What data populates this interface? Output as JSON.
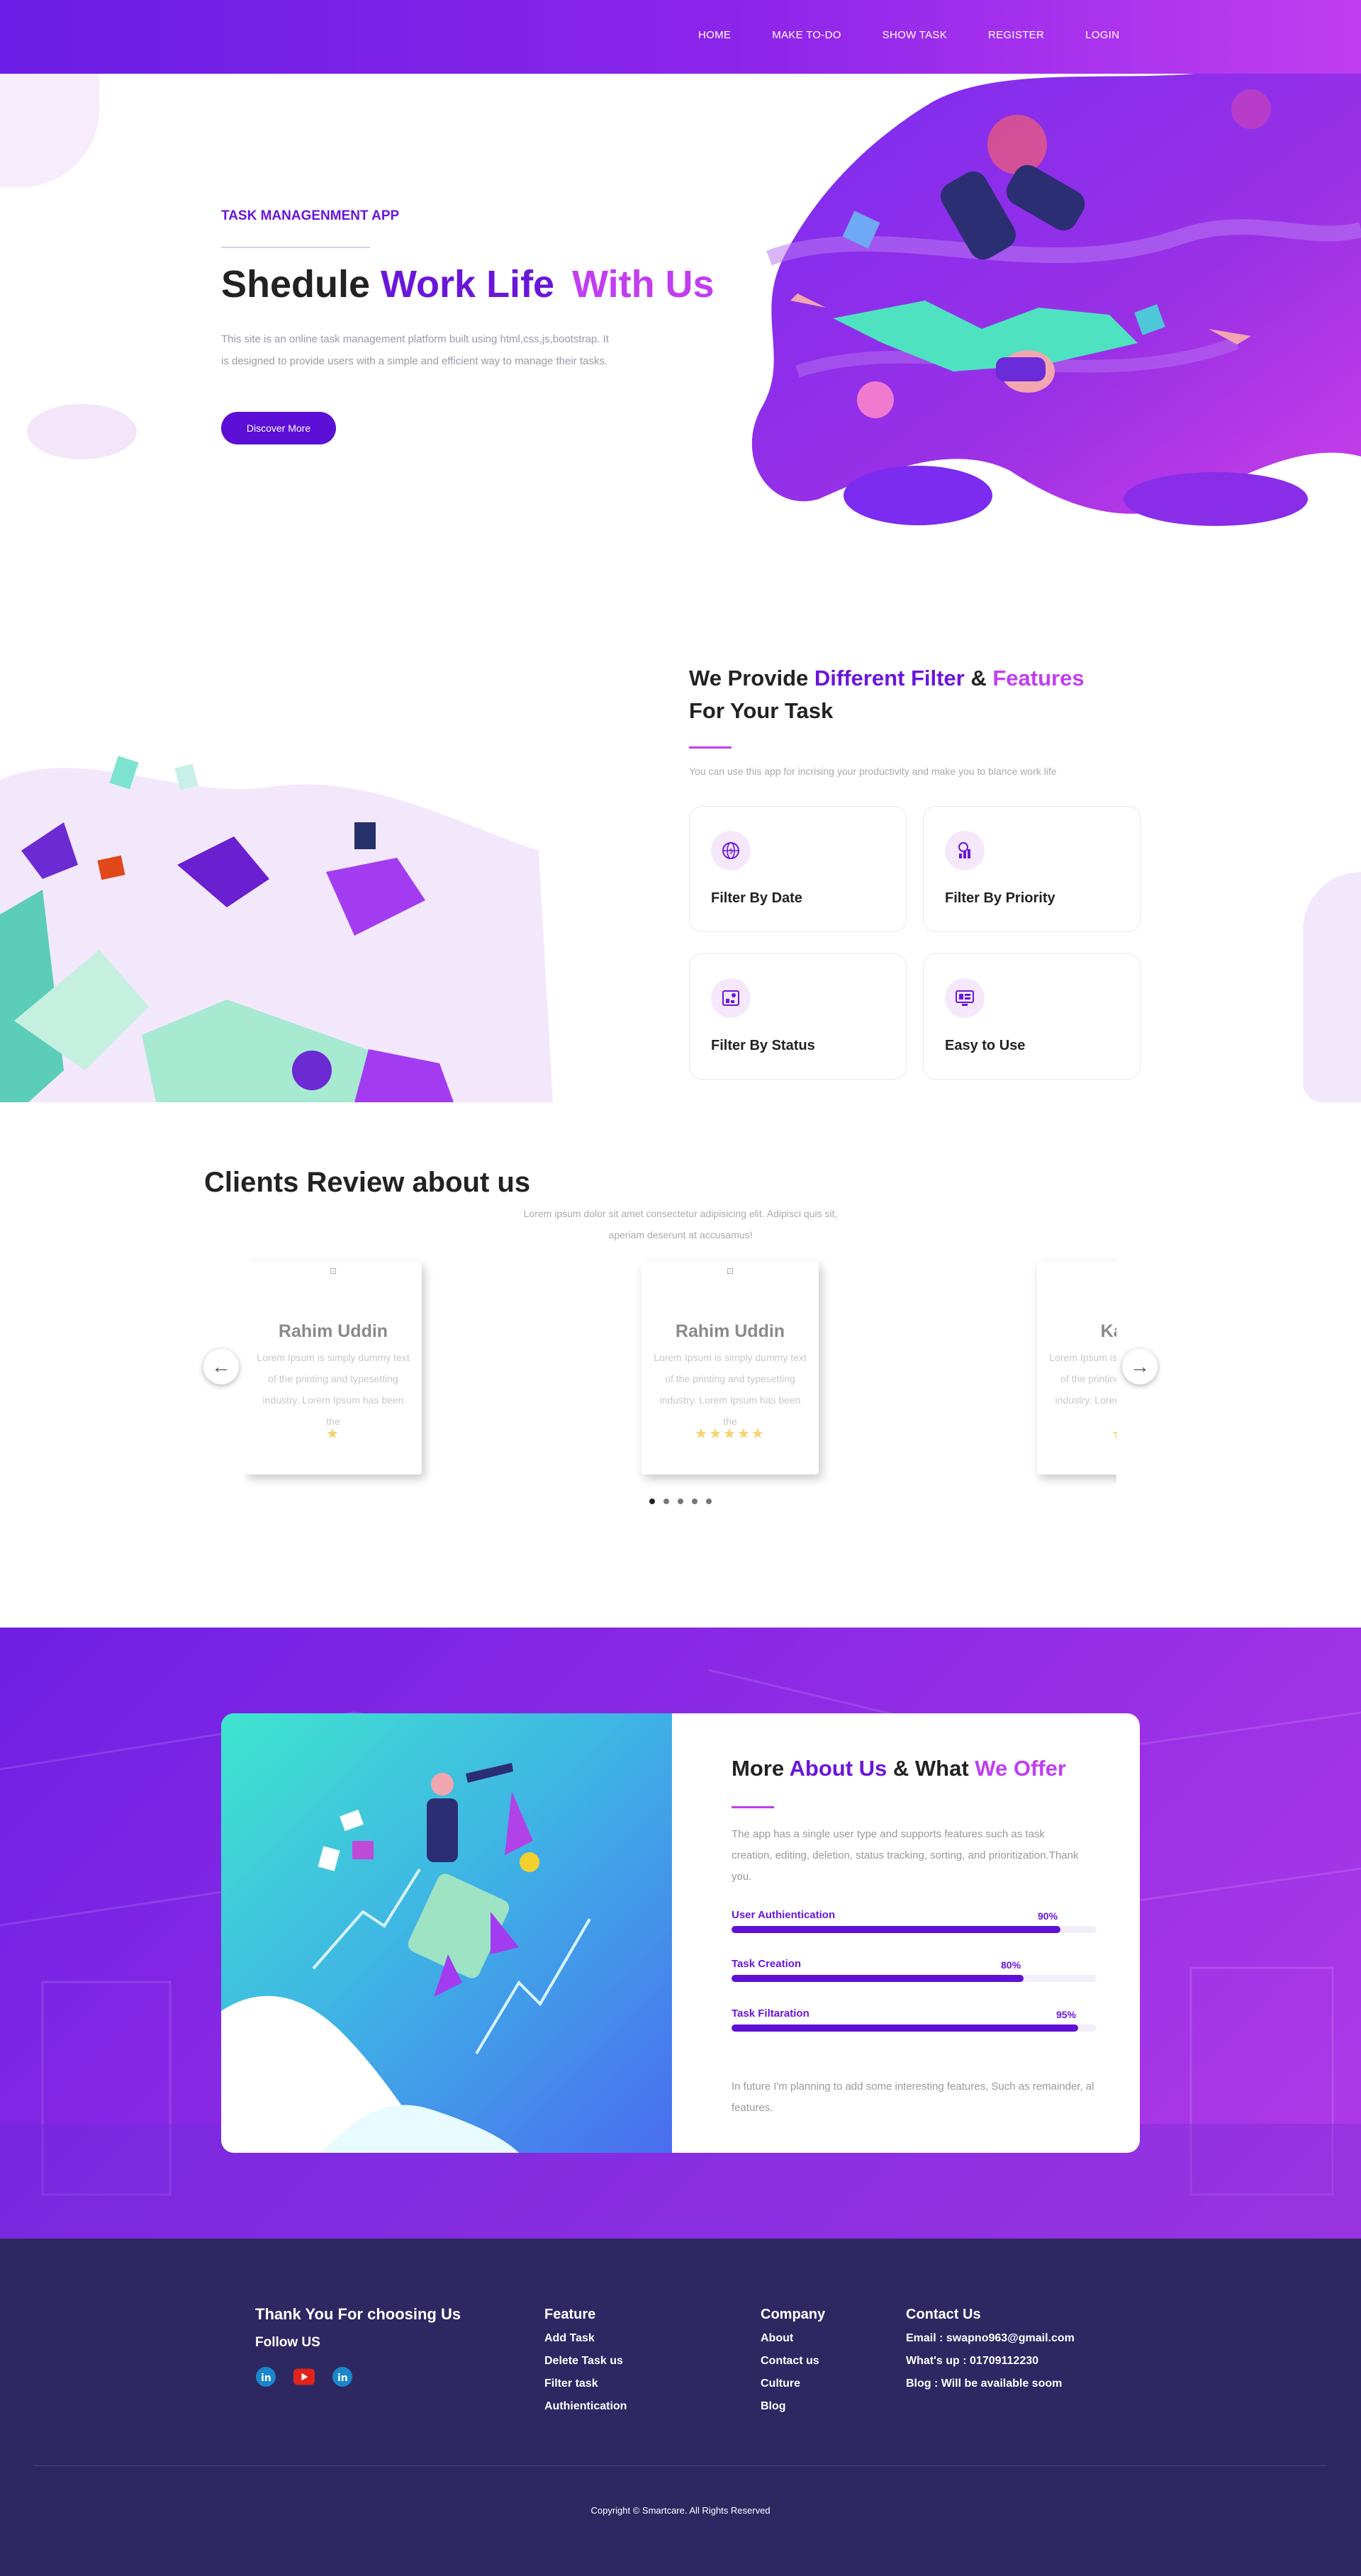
{
  "nav": {
    "items": [
      "HOME",
      "MAKE TO-DO",
      "SHOW TASK",
      "REGISTER",
      "LOGIN"
    ]
  },
  "hero": {
    "kicker": "TASK MANAGENMENT APP",
    "title_a": "Shedule ",
    "title_b": "Work Life ",
    "title_c": "With Us",
    "desc": "This site is an online task management platform built using html,css,js,bootstrap. It is designed to provide users with a simple and efficient way to manage their tasks.",
    "button": "Discover More"
  },
  "features": {
    "title_a": "We Provide ",
    "title_b": "Different Filter",
    "title_c": " & ",
    "title_d": "Features",
    "title_e": "For Your Task",
    "desc": "You can use this app for incrising your productivity and make you to blance work life",
    "cards": [
      {
        "label": "Filter By Date",
        "icon": "globe-icon"
      },
      {
        "label": "Filter By Priority",
        "icon": "chart-user-icon"
      },
      {
        "label": "Filter By Status",
        "icon": "status-board-icon"
      },
      {
        "label": "Easy to Use",
        "icon": "monitor-icon"
      }
    ]
  },
  "reviews": {
    "title": "Clients Review about us",
    "subtitle": "Lorem ipsum dolor sit amet consectetur adipisicing elit. Adipisci quis sit, aperiam deserunt at accusamus!",
    "cards": [
      {
        "name": "Rahim Uddin",
        "text": "Lorem Ipsum is simply dummy text of the printing and typesetting industry. Lorem Ipsum has been the",
        "stars": "★",
        "rating": 1
      },
      {
        "name": "Rahim Uddin",
        "text": "Lorem Ipsum is simply dummy text of the printing and typesetting industry. Lorem Ipsum has been the",
        "stars": "★★★★★",
        "rating": 5
      },
      {
        "name": "Karim",
        "text": "Lorem Ipsum is simply dummy text of the printing and typesetting industry. Lorem Ipsum has been the",
        "stars": "★★",
        "rating": 2
      }
    ],
    "prev_icon": "arrow-left-icon",
    "next_icon": "arrow-right-icon",
    "dots": 5,
    "active_dot": 1
  },
  "about": {
    "title_a": "More ",
    "title_b": "About Us",
    "title_c": " & What ",
    "title_d": "We Offer",
    "desc": "The app has a single user type and supports features such as task creation, editing, deletion, status tracking, sorting, and prioritization.Thank you.",
    "skills": [
      {
        "name": "User Authientication",
        "percent": "90%",
        "value": 90
      },
      {
        "name": "Task Creation",
        "percent": "80%",
        "value": 80
      },
      {
        "name": "Task Filtaration",
        "percent": "95%",
        "value": 95
      }
    ],
    "footer_text": "In future I'm planning to add some interesting features, Such as remainder, al features."
  },
  "footer": {
    "brand": "Thank You For choosing Us",
    "follow": "Follow US",
    "social": [
      "linkedin-icon",
      "youtube-icon",
      "linkedin-icon"
    ],
    "feature": {
      "title": "Feature",
      "links": [
        "Add Task",
        "Delete Task us",
        "Filter task",
        "Authientication"
      ]
    },
    "company": {
      "title": "Company",
      "links": [
        "About",
        "Contact us",
        "Culture",
        "Blog"
      ]
    },
    "contact": {
      "title": "Contact Us",
      "lines": [
        "Email : swapno963@gmail.com",
        "What's up : 01709112230",
        "Blog : Will be available soom"
      ]
    },
    "copyright": "Copyright © Smartcare. All Rights Reserved"
  },
  "colors": {
    "primary": "#6a16d9",
    "accent": "#c03ef0",
    "footer": "#2d2762",
    "star": "#f4d36b"
  }
}
